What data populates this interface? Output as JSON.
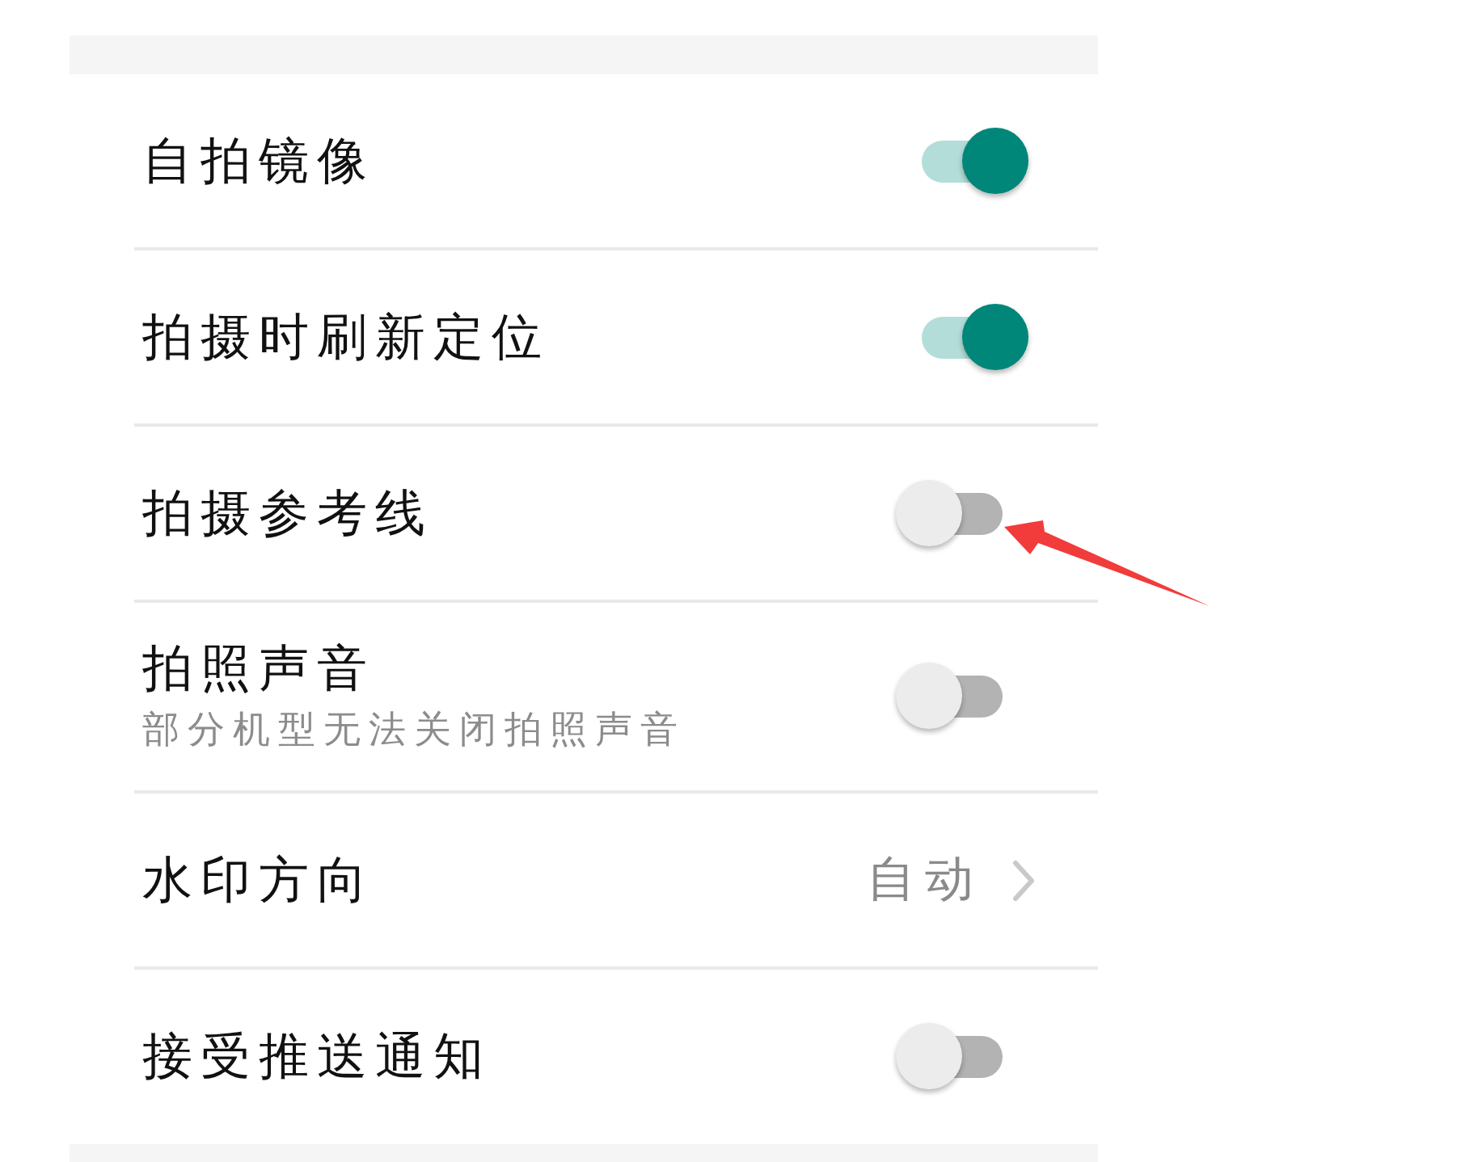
{
  "settings": [
    {
      "kind": "toggle",
      "title": "自拍镜像",
      "on": true,
      "arrow_pointed": false
    },
    {
      "kind": "toggle",
      "title": "拍摄时刷新定位",
      "on": true,
      "arrow_pointed": false
    },
    {
      "kind": "toggle",
      "title": "拍摄参考线",
      "on": false,
      "arrow_pointed": true
    },
    {
      "kind": "toggle",
      "title": "拍照声音",
      "subtitle": "部分机型无法关闭拍照声音",
      "on": false,
      "arrow_pointed": false
    },
    {
      "kind": "link",
      "title": "水印方向",
      "value": "自动",
      "arrow_pointed": false
    },
    {
      "kind": "toggle",
      "title": "接受推送通知",
      "on": false,
      "arrow_pointed": false
    }
  ]
}
